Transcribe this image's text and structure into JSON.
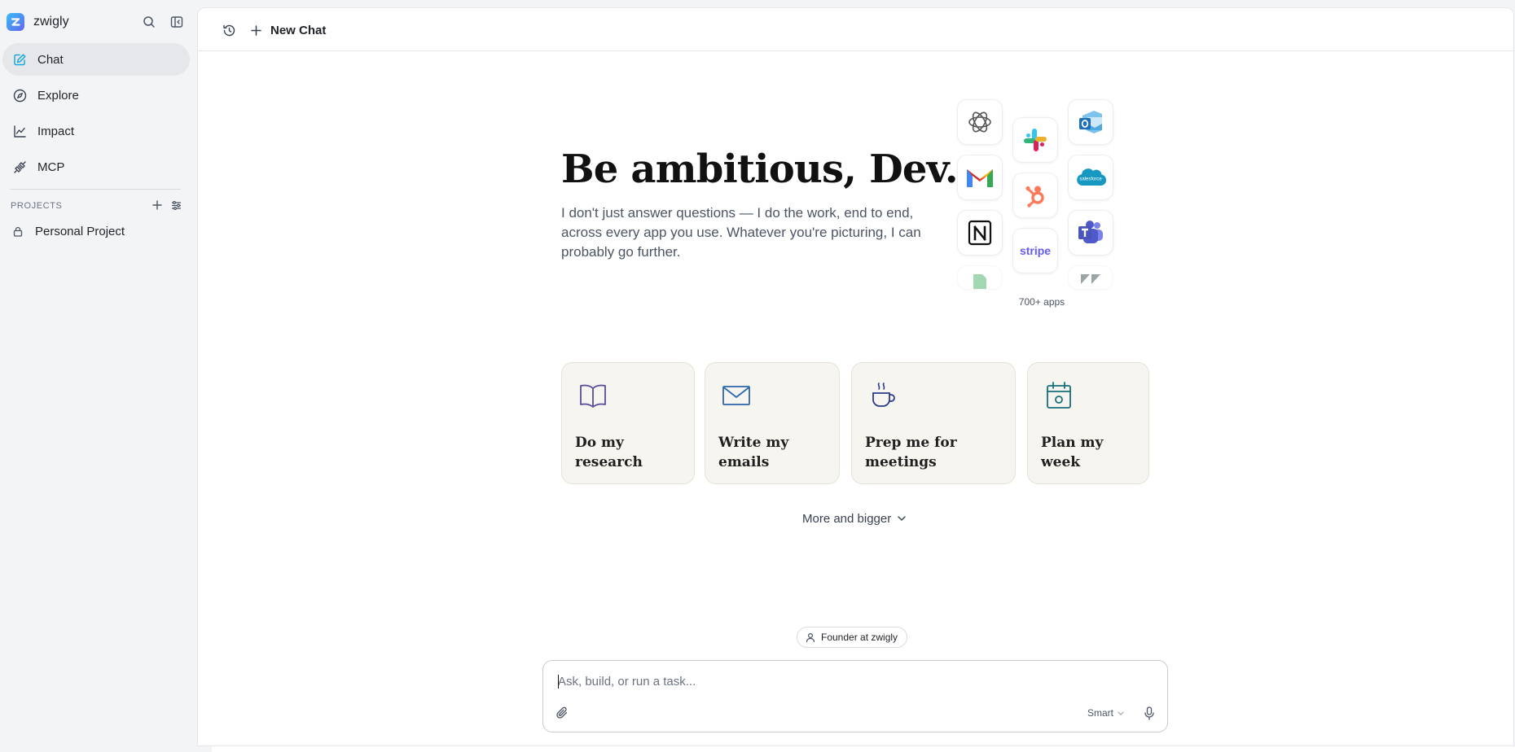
{
  "sidebar": {
    "brand_name": "zwigly",
    "nav": [
      {
        "label": "Chat",
        "icon": "edit-icon",
        "active": true
      },
      {
        "label": "Explore",
        "icon": "compass-icon"
      },
      {
        "label": "Impact",
        "icon": "chart-line-icon"
      },
      {
        "label": "MCP",
        "icon": "plug-icon"
      }
    ],
    "projects_title": "PROJECTS",
    "projects": [
      {
        "label": "Personal Project",
        "icon": "lock-icon"
      }
    ]
  },
  "topbar": {
    "new_chat_label": "New Chat"
  },
  "hero": {
    "title": "Be ambitious, Dev.",
    "subtitle": "I don't just answer questions — I do the work, end to end, across every app you use. Whatever you're picturing, I can probably go further."
  },
  "apps": {
    "caption": "700+ apps",
    "stripe_label": "stripe",
    "salesforce_label": "salesforce",
    "items": [
      "openai-icon",
      "slack-icon",
      "outlook-icon",
      "gmail-icon",
      "hubspot-icon",
      "salesforce-icon",
      "notion-icon",
      "stripe-icon",
      "teams-icon",
      "sheets-icon",
      "zendesk-icon"
    ]
  },
  "cards": [
    {
      "line1": "Do my",
      "line2": "research",
      "icon": "book-icon",
      "color": "#5b4b9a"
    },
    {
      "line1": "Write my",
      "line2": "emails",
      "icon": "mail-icon",
      "color": "#2d67b0"
    },
    {
      "line1": "Prep me for",
      "line2": "meetings",
      "icon": "coffee-icon",
      "color": "#2a3a8c"
    },
    {
      "line1": "Plan my",
      "line2": "week",
      "icon": "calendar-icon",
      "color": "#16707a"
    }
  ],
  "more_label": "More and bigger",
  "role_label": "Founder at zwigly",
  "composer": {
    "placeholder": "Ask, build, or run a task...",
    "model": "Smart"
  },
  "colors": {
    "accent": "#1ba8e0",
    "sidebar_bg": "#f3f4f6",
    "card_bg": "#f7f5f0"
  }
}
